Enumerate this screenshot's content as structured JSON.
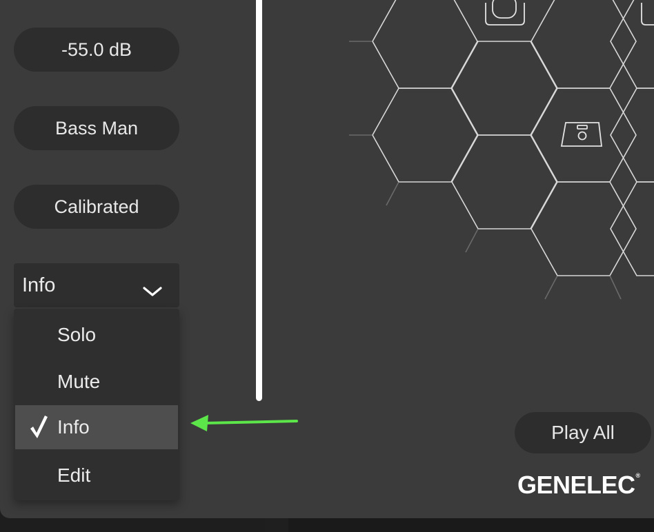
{
  "left_panel": {
    "volume_label": "-55.0 dB",
    "bass_label": "Bass Man",
    "calibration_label": "Calibrated"
  },
  "mode_select": {
    "selected": "Info",
    "options": [
      {
        "label": "Solo",
        "checked": false
      },
      {
        "label": "Mute",
        "checked": false
      },
      {
        "label": "Info",
        "checked": true
      },
      {
        "label": "Edit",
        "checked": false
      }
    ]
  },
  "play_all_label": "Play All",
  "brand": {
    "name": "GENELEC",
    "mark": "®"
  },
  "colors": {
    "window_bg": "#3b3b3b",
    "pill_bg": "#2d2d2d",
    "menu_selected_bg": "#4e4e4e",
    "annotation_arrow": "#5ce64a"
  },
  "icons": [
    "chevron-down-icon",
    "checkmark-icon",
    "speaker-icon"
  ]
}
